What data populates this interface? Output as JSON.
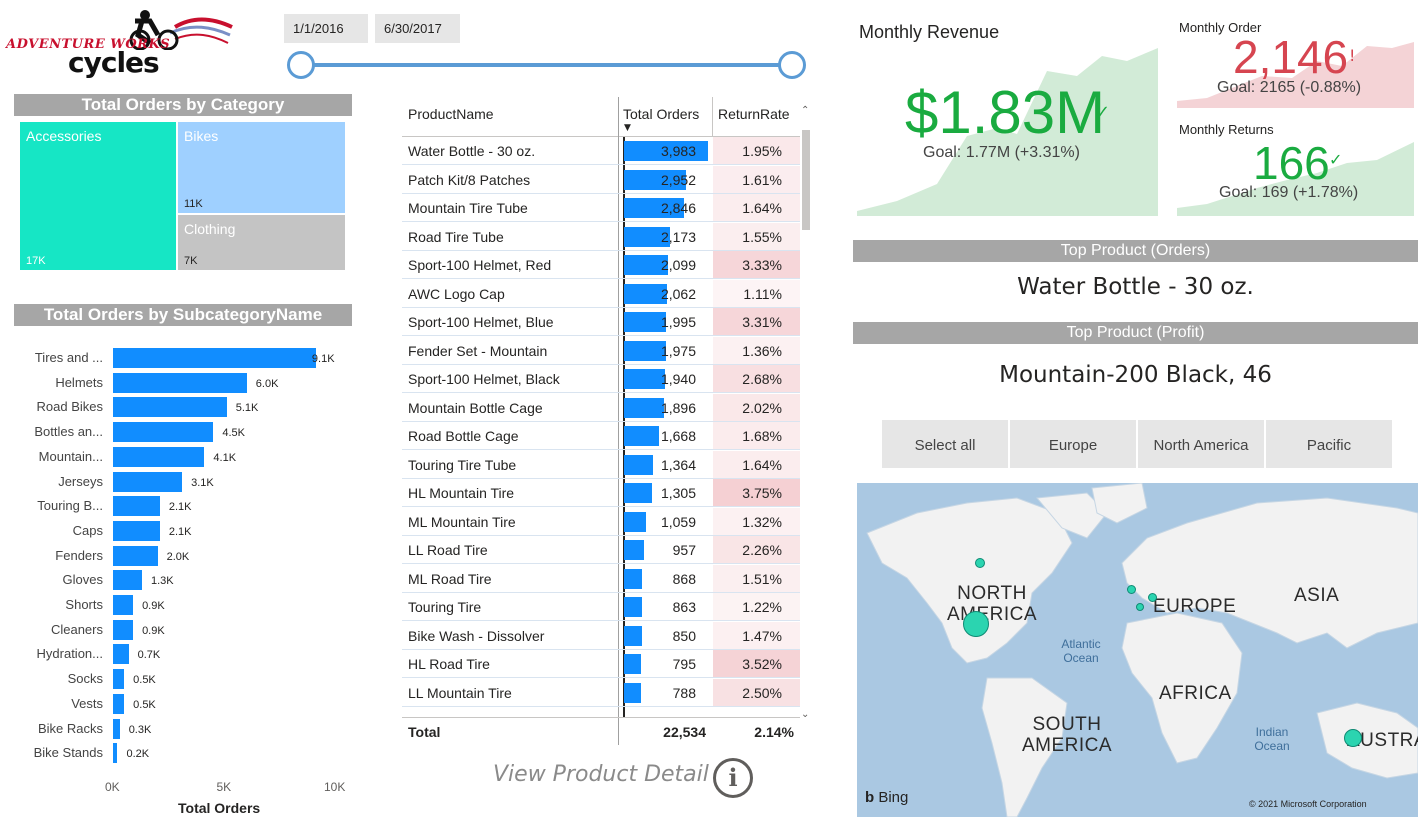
{
  "logo": {
    "line1": "ADVENTURE WORKS",
    "line2": "cycles"
  },
  "date_slicer": {
    "start": "1/1/2016",
    "end": "6/30/2017"
  },
  "treemap": {
    "title": "Total Orders by Category",
    "items": [
      {
        "name": "Accessories",
        "value": "17K",
        "color": "#16e6c5"
      },
      {
        "name": "Bikes",
        "value": "11K",
        "color": "#9fd0ff"
      },
      {
        "name": "Clothing",
        "value": "7K",
        "color": "#c4c4c4"
      }
    ]
  },
  "subcat_chart": {
    "title": "Total Orders by SubcategoryName",
    "xlabel": "Total Orders",
    "xticks": [
      "0K",
      "5K",
      "10K"
    ],
    "xmax": 10000
  },
  "chart_data": {
    "type": "bar",
    "orientation": "horizontal",
    "title": "Total Orders by SubcategoryName",
    "xlabel": "Total Orders",
    "xlim": [
      0,
      10000
    ],
    "categories": [
      "Tires and ...",
      "Helmets",
      "Road Bikes",
      "Bottles an...",
      "Mountain...",
      "Jerseys",
      "Touring B...",
      "Caps",
      "Fenders",
      "Gloves",
      "Shorts",
      "Cleaners",
      "Hydration...",
      "Socks",
      "Vests",
      "Bike Racks",
      "Bike Stands"
    ],
    "values": [
      9100,
      6000,
      5100,
      4500,
      4100,
      3100,
      2100,
      2100,
      2000,
      1300,
      900,
      900,
      700,
      500,
      500,
      300,
      200
    ],
    "labels": [
      "9.1K",
      "6.0K",
      "5.1K",
      "4.5K",
      "4.1K",
      "3.1K",
      "2.1K",
      "2.1K",
      "2.0K",
      "1.3K",
      "0.9K",
      "0.9K",
      "0.7K",
      "0.5K",
      "0.5K",
      "0.3K",
      "0.2K"
    ]
  },
  "product_table": {
    "headers": {
      "name": "ProductName",
      "orders": "Total Orders",
      "rate": "ReturnRate"
    },
    "max_orders": 3983,
    "rows": [
      {
        "name": "Water Bottle - 30 oz.",
        "orders": "3,983",
        "n": 3983,
        "rate": "1.95%",
        "r": 1.95
      },
      {
        "name": "Patch Kit/8 Patches",
        "orders": "2,952",
        "n": 2952,
        "rate": "1.61%",
        "r": 1.61
      },
      {
        "name": "Mountain Tire Tube",
        "orders": "2,846",
        "n": 2846,
        "rate": "1.64%",
        "r": 1.64
      },
      {
        "name": "Road Tire Tube",
        "orders": "2,173",
        "n": 2173,
        "rate": "1.55%",
        "r": 1.55
      },
      {
        "name": "Sport-100 Helmet, Red",
        "orders": "2,099",
        "n": 2099,
        "rate": "3.33%",
        "r": 3.33
      },
      {
        "name": "AWC Logo Cap",
        "orders": "2,062",
        "n": 2062,
        "rate": "1.11%",
        "r": 1.11
      },
      {
        "name": "Sport-100 Helmet, Blue",
        "orders": "1,995",
        "n": 1995,
        "rate": "3.31%",
        "r": 3.31
      },
      {
        "name": "Fender Set - Mountain",
        "orders": "1,975",
        "n": 1975,
        "rate": "1.36%",
        "r": 1.36
      },
      {
        "name": "Sport-100 Helmet, Black",
        "orders": "1,940",
        "n": 1940,
        "rate": "2.68%",
        "r": 2.68
      },
      {
        "name": "Mountain Bottle Cage",
        "orders": "1,896",
        "n": 1896,
        "rate": "2.02%",
        "r": 2.02
      },
      {
        "name": "Road Bottle Cage",
        "orders": "1,668",
        "n": 1668,
        "rate": "1.68%",
        "r": 1.68
      },
      {
        "name": "Touring Tire Tube",
        "orders": "1,364",
        "n": 1364,
        "rate": "1.64%",
        "r": 1.64
      },
      {
        "name": "HL Mountain Tire",
        "orders": "1,305",
        "n": 1305,
        "rate": "3.75%",
        "r": 3.75
      },
      {
        "name": "ML Mountain Tire",
        "orders": "1,059",
        "n": 1059,
        "rate": "1.32%",
        "r": 1.32
      },
      {
        "name": "LL Road Tire",
        "orders": "957",
        "n": 957,
        "rate": "2.26%",
        "r": 2.26
      },
      {
        "name": "ML Road Tire",
        "orders": "868",
        "n": 868,
        "rate": "1.51%",
        "r": 1.51
      },
      {
        "name": "Touring Tire",
        "orders": "863",
        "n": 863,
        "rate": "1.22%",
        "r": 1.22
      },
      {
        "name": "Bike Wash - Dissolver",
        "orders": "850",
        "n": 850,
        "rate": "1.47%",
        "r": 1.47
      },
      {
        "name": "HL Road Tire",
        "orders": "795",
        "n": 795,
        "rate": "3.52%",
        "r": 3.52
      },
      {
        "name": "LL Mountain Tire",
        "orders": "788",
        "n": 788,
        "rate": "2.50%",
        "r": 2.5
      }
    ],
    "total": {
      "label": "Total",
      "orders": "22,534",
      "rate": "2.14%"
    }
  },
  "view_detail": {
    "label": "View Product Detail",
    "icon": "info-icon"
  },
  "kpis": {
    "revenue": {
      "title": "Monthly Revenue",
      "value": "$1.83M",
      "goal": "Goal: 1.77M (+3.31%)",
      "status": "✓",
      "color": "#1aab40"
    },
    "orders": {
      "title": "Monthly Order",
      "value": "2,146",
      "goal": "Goal: 2165 (-0.88%)",
      "status": "!",
      "color": "#d64550"
    },
    "returns": {
      "title": "Monthly Returns",
      "value": "166",
      "goal": "Goal: 169 (+1.78%)",
      "status": "✓",
      "color": "#1aab40"
    }
  },
  "top_orders": {
    "title": "Top Product (Orders)",
    "value": "Water Bottle - 30 oz."
  },
  "top_profit": {
    "title": "Top Product (Profit)",
    "value": "Mountain-200 Black, 46"
  },
  "region_slicer": {
    "items": [
      "Select all",
      "Europe",
      "North America",
      "Pacific"
    ]
  },
  "map": {
    "labels": {
      "na": "NORTH\nAMERICA",
      "europe": "EUROPE",
      "asia": "ASIA",
      "africa": "AFRICA",
      "sa": "SOUTH\nAMERICA",
      "aus": "AUSTRA",
      "atlantic": "Atlantic\nOcean",
      "indian": "Indian\nOcean"
    },
    "attribution": "© 2021 Microsoft Corporation",
    "bing": "Bing"
  }
}
